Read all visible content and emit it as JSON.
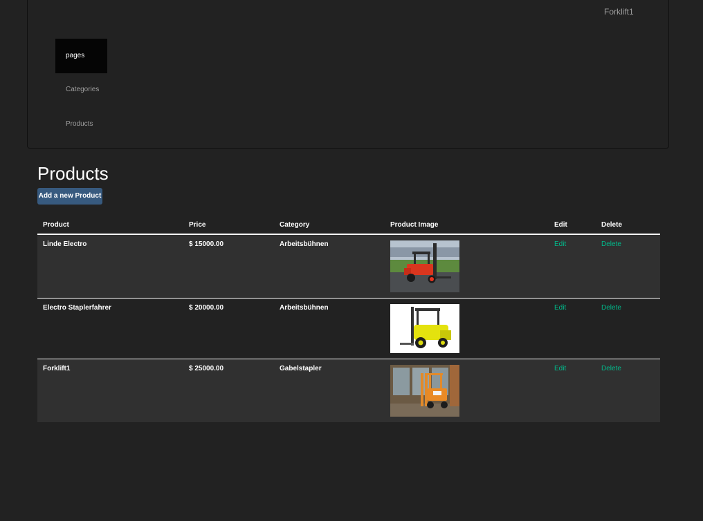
{
  "nav": {
    "brand": "Forklift1",
    "items": [
      {
        "label": "pages"
      },
      {
        "label": "Categories"
      },
      {
        "label": "Products"
      }
    ]
  },
  "main": {
    "title": "Products",
    "add_button": "Add a new Product",
    "table": {
      "headers": [
        "Product",
        "Price",
        "Category",
        "Product Image",
        "Edit",
        "Delete"
      ],
      "rows": [
        {
          "product": "Linde Electro",
          "price": "$ 15000.00",
          "category": "Arbeitsbühnen",
          "edit": "Edit",
          "delete": "Delete",
          "image": "red-forklift-image"
        },
        {
          "product": "Electro Staplerfahrer",
          "price": "$ 20000.00",
          "category": "Arbeitsbühnen",
          "edit": "Edit",
          "delete": "Delete",
          "image": "yellow-forklift-image"
        },
        {
          "product": "Forklift1",
          "price": "$ 25000.00",
          "category": "Gabelstapler",
          "edit": "Edit",
          "delete": "Delete",
          "image": "orange-forklift-image"
        }
      ]
    }
  },
  "colors": {
    "background": "#222222",
    "row_alt": "#303030",
    "button": "#375a7f",
    "link": "#00bc8c",
    "nav_muted": "#9d9d9d",
    "nav_active": "#050505"
  }
}
